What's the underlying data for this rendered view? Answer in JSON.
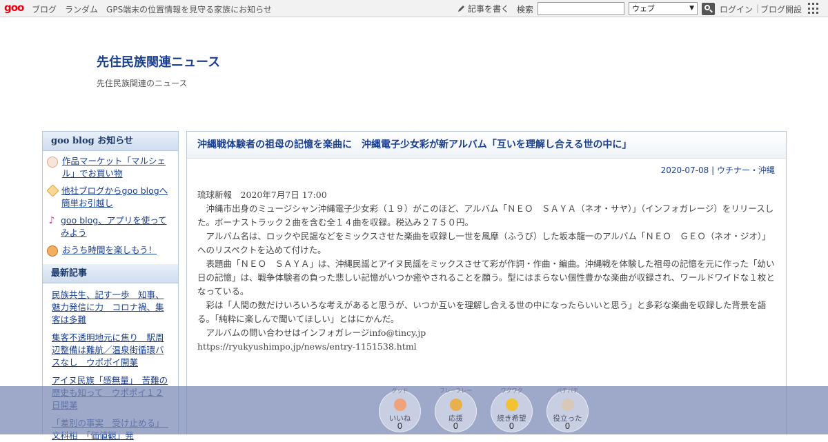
{
  "topbar": {
    "logo": "goo",
    "nav": [
      "ブログ",
      "ランダム",
      "GPS端末の位置情報を見守る家族にお知らせ"
    ],
    "write_label": "記事を書く",
    "search_label": "検索",
    "search_value": "",
    "search_scope": "ウェブ",
    "login": "ログイン",
    "open_blog": "ブログ開設"
  },
  "header": {
    "title": "先住民族関連ニュース",
    "description": "先住民族関連のニュース"
  },
  "sidebar": {
    "notice_heading": "goo blog お知らせ",
    "notices": [
      {
        "icon": "fox-icon",
        "label": "作品マーケット「マルシェル」でお買い物"
      },
      {
        "icon": "flower-icon",
        "label": "他社ブログからgoo blogへ簡単お引越し"
      },
      {
        "icon": "music-note-icon",
        "label": "goo blog、アプリを使ってみよう"
      },
      {
        "icon": "dog-icon",
        "label": "おうち時間を楽しもう！"
      }
    ],
    "recent_heading": "最新記事",
    "recent": [
      "民族共生、記す一歩　知事、魅力発信に力　コロナ禍、集客は多難",
      "集客不透明地元に焦り　駅周辺整備は難航／温泉街循環バスなし　ウポポイ開業",
      "アイヌ民族「感無量」　苦難の歴史も知って　ウポポイ１２日開業",
      "「差別の事実　受け止める」　文科相　「価値観」発"
    ]
  },
  "entry": {
    "title": "沖縄戦体験者の祖母の記憶を楽曲に　沖縄電子少女彩が新アルバム「互いを理解し合える世の中に」",
    "date": "2020-07-08",
    "meta_sep": " | ",
    "category": "ウチナー・沖縄",
    "source": "琉球新報　2020年7月7日 17:00",
    "paragraphs": [
      "沖縄市出身のミュージシャン沖縄電子少女彩（１９）がこのほど、アルバム「ＮＥＯ　ＳＡＹＡ（ネオ・サヤ）」（インフォガレージ）をリリースした。ボーナストラック２曲を含む全１４曲を収録。税込み２７５０円。",
      "アルバム名は、ロックや民謡などをミックスさせた楽曲を収録し一世を風靡（ふうび）した坂本龍一のアルバム「ＮＥＯ　ＧＥＯ（ネオ・ジオ）」へのリスペクトを込めて付けた。",
      "表題曲「ＮＥＯ　ＳＡＹＡ」は、沖縄民謡とアイヌ民謡をミックスさせて彩が作詞・作曲・編曲。沖縄戦を体験した祖母の記憶を元に作った「幼い日の記憶」は、戦争体験者の負った悲しい記憶がいつか癒やされることを願う。型にはまらない個性豊かな楽曲が収録され、ワールドワイドな１枚となっている。",
      "彩は「人間の数だけいろいろな考えがあると思うが、いつか互いを理解し合える世の中になったらいいと思う」と多彩な楽曲を収録した背景を語る。「純粋に楽しんで聞いてほしい」とはにかんだ。",
      "アルバムの問い合わせはインフォガレージinfo@tincy.jp"
    ],
    "url": "https://ryukyushimpo.jp/news/entry-1151538.html"
  },
  "reactions": [
    {
      "tag": "グッド",
      "label": "いいね",
      "count": "0",
      "icon": "thumbs-up-icon",
      "color": "#f0a27a"
    },
    {
      "tag": "フレーフレー",
      "label": "応援",
      "count": "0",
      "icon": "megaphone-icon",
      "color": "#e8b04a"
    },
    {
      "tag": "ワクワク",
      "label": "続き希望",
      "count": "0",
      "icon": "heart-eyes-icon",
      "color": "#f2c230"
    },
    {
      "tag": "パチパチ",
      "label": "役立った",
      "count": "0",
      "icon": "clap-icon",
      "color": "#d8c8b8"
    }
  ]
}
